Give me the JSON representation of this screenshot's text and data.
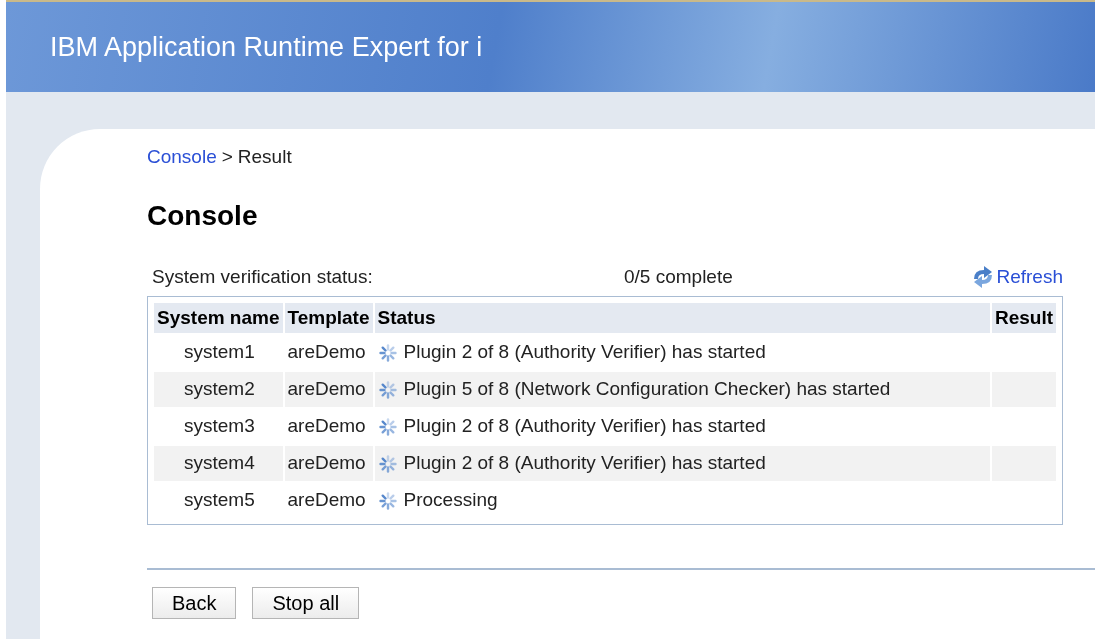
{
  "header": {
    "title": "IBM Application Runtime Expert for i"
  },
  "breadcrumb": {
    "link": "Console",
    "separator": ">",
    "current": "Result"
  },
  "page_title": "Console",
  "status_bar": {
    "label": "System verification status:",
    "progress": "0/5 complete",
    "refresh": "Refresh"
  },
  "table": {
    "columns": [
      "System name",
      "Template",
      "Status",
      "Result"
    ],
    "rows": [
      {
        "system": "system1",
        "template": "areDemo",
        "status": "Plugin 2 of 8 (Authority Verifier) has started"
      },
      {
        "system": "system2",
        "template": "areDemo",
        "status": "Plugin 5 of 8 (Network Configuration Checker) has started"
      },
      {
        "system": "system3",
        "template": "areDemo",
        "status": "Plugin 2 of 8 (Authority Verifier) has started"
      },
      {
        "system": "system4",
        "template": "areDemo",
        "status": "Plugin 2 of 8 (Authority Verifier) has started"
      },
      {
        "system": "system5",
        "template": "areDemo",
        "status": "Processing"
      }
    ]
  },
  "buttons": [
    "Back",
    "Stop all"
  ]
}
